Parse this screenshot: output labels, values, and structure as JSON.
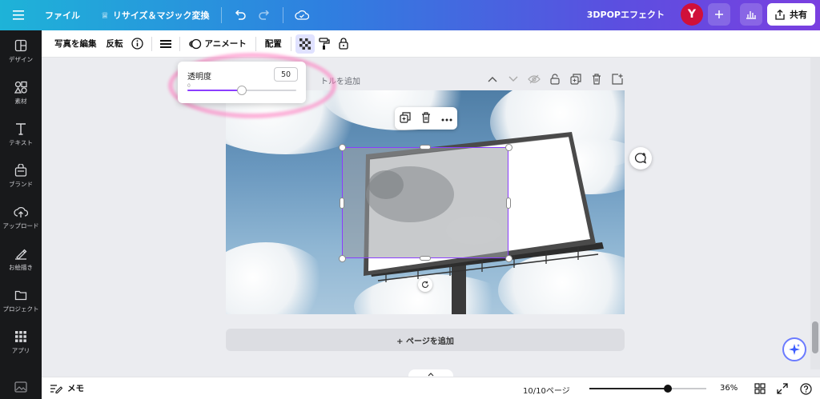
{
  "topbar": {
    "menu_icon": "hamburger-icon",
    "file_label": "ファイル",
    "resize_label": "リサイズ＆マジック変換",
    "project_title": "3DPOPエフェクト",
    "avatar_letter": "Y",
    "share_label": "共有"
  },
  "sidebar": {
    "items": [
      {
        "label": "デザイン",
        "icon": "layout-icon"
      },
      {
        "label": "素材",
        "icon": "shapes-icon"
      },
      {
        "label": "テキスト",
        "icon": "text-icon"
      },
      {
        "label": "ブランド",
        "icon": "brand-icon"
      },
      {
        "label": "アップロード",
        "icon": "upload-icon"
      },
      {
        "label": "お絵描き",
        "icon": "draw-icon"
      },
      {
        "label": "プロジェクト",
        "icon": "folder-icon"
      },
      {
        "label": "アプリ",
        "icon": "apps-icon"
      }
    ]
  },
  "ctxbar": {
    "edit_photo": "写真を編集",
    "flip": "反転",
    "animate": "アニメート",
    "position": "配置"
  },
  "transparency": {
    "label": "透明度",
    "value": "50",
    "min_label": "0",
    "level": 0.5
  },
  "canvas": {
    "page_title_hint": "トルを追加",
    "add_page": "+ ページを追加"
  },
  "bottombar": {
    "memo": "メモ",
    "pages": "10/10ページ",
    "zoom": "36%",
    "zoom_level": 0.67
  },
  "colors": {
    "accent": "#8b3dff",
    "avatar": "#d0103a"
  }
}
